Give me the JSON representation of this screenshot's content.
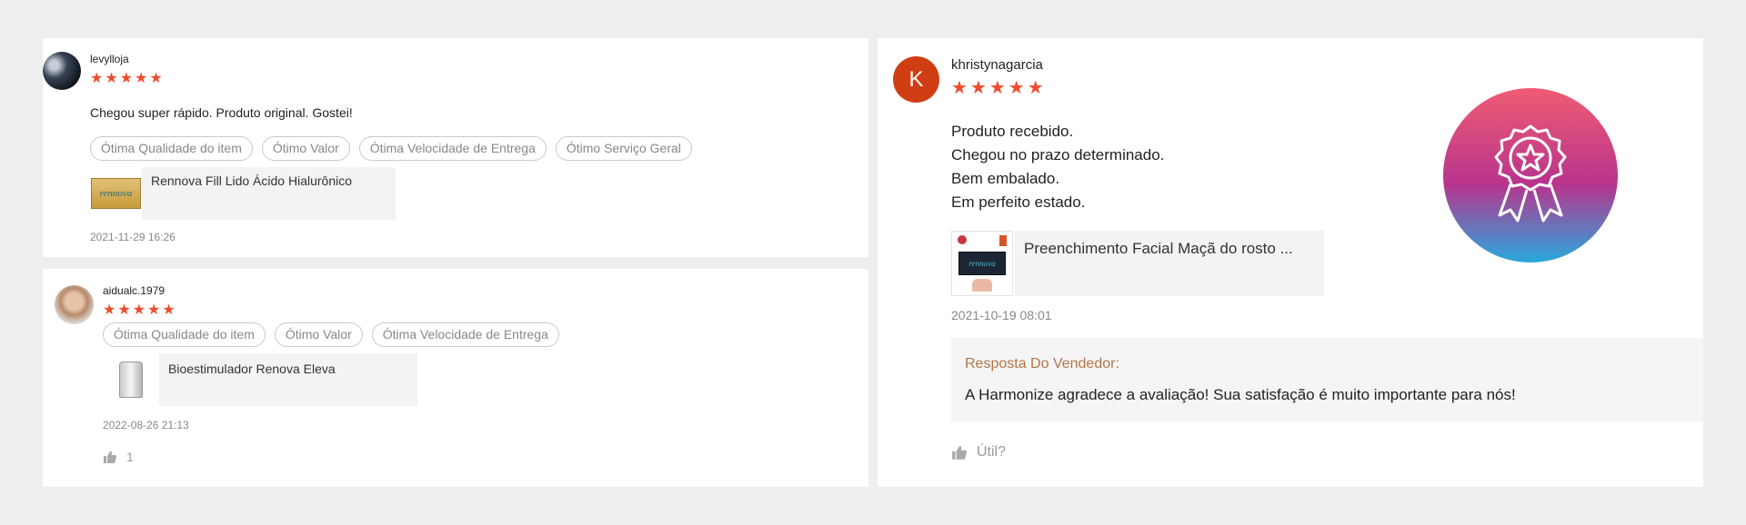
{
  "reviews": [
    {
      "username": "levylloja",
      "rating": 5,
      "stars": "★★★★★",
      "comment": "Chegou super rápido. Produto original. Gostei!",
      "tags": [
        "Ótima Qualidade do item",
        "Ótimo Valor",
        "Ótima Velocidade de Entrega",
        "Ótimo Serviço Geral"
      ],
      "product": {
        "name": "Rennova Fill Lido Ácido Hialurônico",
        "thumb_text": "rennova"
      },
      "date": "2021-11-29 16:26"
    },
    {
      "username": "aidualc.1979",
      "rating": 5,
      "stars": "★★★★★",
      "tags": [
        "Ótima Qualidade do item",
        "Ótimo Valor",
        "Ótima Velocidade de Entrega"
      ],
      "product": {
        "name": "Bioestimulador Renova Eleva"
      },
      "date": "2022-08-26 21:13",
      "likes": "1"
    },
    {
      "username": "khristynagarcia",
      "avatar_letter": "K",
      "rating": 5,
      "stars": "★★★★★",
      "comment_lines": [
        "Produto recebido.",
        "Chegou no prazo determinado.",
        "Bem embalado.",
        "Em perfeito estado."
      ],
      "product": {
        "name": "Preenchimento Facial Maçã do rosto ...",
        "thumb_text": "rennova"
      },
      "date": "2021-10-19 08:01",
      "seller_reply": {
        "title": "Resposta Do Vendedor:",
        "text": "A Harmonize agradece a avaliação! Sua satisfação é muito importante para nós!"
      },
      "helpful_label": "Útil?"
    }
  ],
  "colors": {
    "star": "#ee4d2d",
    "reply_title": "#b37548",
    "avatar_k": "#cf3e12",
    "badge_top": "#f05c73",
    "badge_mid": "#b8348d",
    "badge_bottom": "#2aa8dd"
  },
  "icons": [
    "thumbs-up-icon",
    "award-badge-icon"
  ]
}
